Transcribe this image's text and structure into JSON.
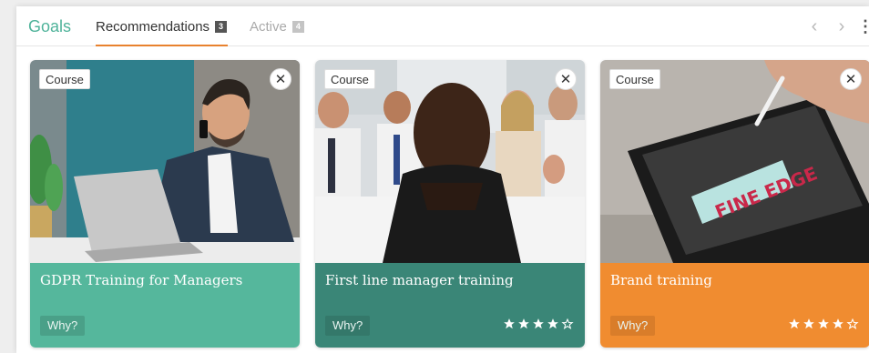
{
  "tabs": {
    "goals_label": "Goals",
    "recommendations_label": "Recommendations",
    "recommendations_count": "3",
    "active_label": "Active",
    "active_count": "4"
  },
  "nav": {
    "prev_icon": "‹",
    "next_icon": "›",
    "more_icon": "⋮"
  },
  "cards": [
    {
      "tag": "Course",
      "title": "GDPR Training for Managers",
      "why": "Why?",
      "rating": null,
      "color": "#55b79c",
      "why_bg": "#4aa088"
    },
    {
      "tag": "Course",
      "title": "First line manager training",
      "why": "Why?",
      "rating": 4,
      "color": "#3a8677",
      "why_bg": "#34786a"
    },
    {
      "tag": "Course",
      "title": "Brand training",
      "why": "Why?",
      "rating": 4,
      "color": "#f08c30",
      "why_bg": "#d97d2a"
    }
  ],
  "colors": {
    "accent_teal": "#4fb39a",
    "accent_orange": "#e8822e"
  }
}
